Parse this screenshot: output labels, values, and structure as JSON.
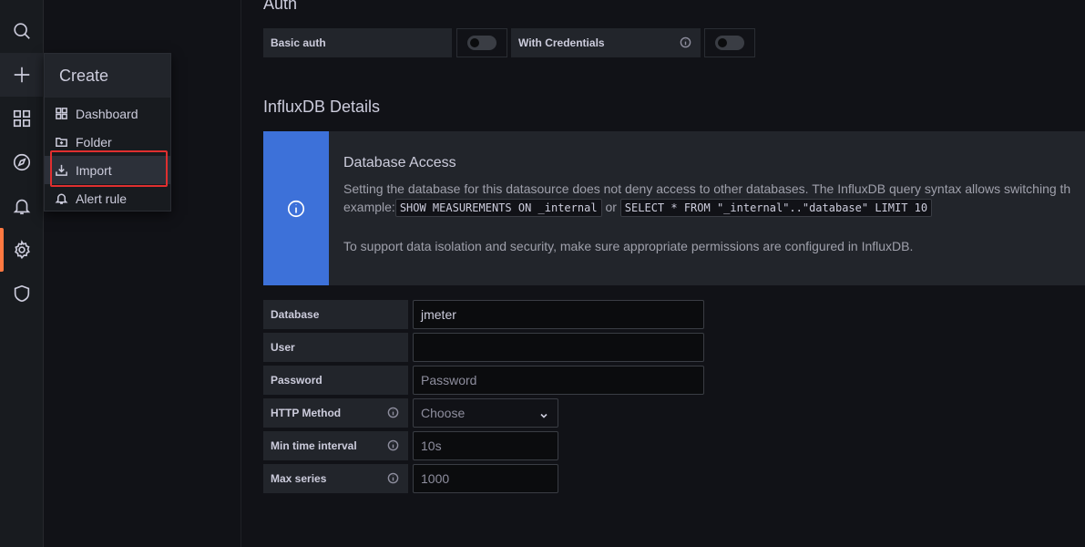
{
  "menu": {
    "title": "Create",
    "items": [
      {
        "label": "Dashboard",
        "icon": "apps-icon"
      },
      {
        "label": "Folder",
        "icon": "folder-plus-icon"
      },
      {
        "label": "Import",
        "icon": "import-icon"
      },
      {
        "label": "Alert rule",
        "icon": "bell-icon"
      }
    ]
  },
  "rail": [
    "search-icon",
    "plus-icon",
    "apps-icon",
    "compass-icon",
    "bell-icon",
    "gear-icon",
    "shield-icon"
  ],
  "auth": {
    "title": "Auth",
    "basic_auth_label": "Basic auth",
    "with_credentials_label": "With Credentials"
  },
  "details": {
    "title": "InfluxDB Details"
  },
  "alert": {
    "title": "Database Access",
    "line1": "Setting the database for this datasource does not deny access to other databases. The InfluxDB query syntax allows switching th",
    "example_prefix": "example:",
    "code1": "SHOW MEASUREMENTS ON _internal",
    "or_text": "or",
    "code2": "SELECT * FROM \"_internal\"..\"database\" LIMIT 10",
    "line2": "To support data isolation and security, make sure appropriate permissions are configured in InfluxDB."
  },
  "form": {
    "database": {
      "label": "Database",
      "value": "jmeter"
    },
    "user": {
      "label": "User",
      "value": ""
    },
    "password": {
      "label": "Password",
      "placeholder": "Password"
    },
    "http_method": {
      "label": "HTTP Method",
      "placeholder": "Choose"
    },
    "min_time_interval": {
      "label": "Min time interval",
      "placeholder": "10s"
    },
    "max_series": {
      "label": "Max series",
      "placeholder": "1000"
    }
  },
  "colors": {
    "accent_blue": "#3d71d9",
    "active_marker": "#ff7941",
    "highlight_box": "#e02f2f"
  }
}
